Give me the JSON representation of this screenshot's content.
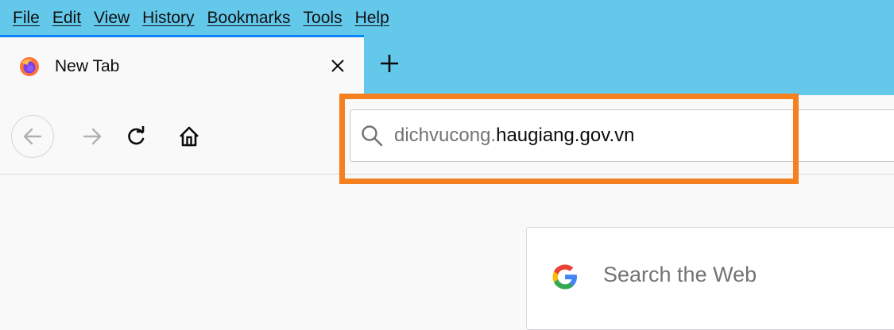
{
  "menu": [
    "File",
    "Edit",
    "View",
    "History",
    "Bookmarks",
    "Tools",
    "Help"
  ],
  "tab": {
    "title": "New Tab",
    "close_glyph": "×",
    "icon": "firefox-logo-icon"
  },
  "new_tab_glyph": "+",
  "toolbar": {
    "back_icon": "back-arrow-icon",
    "forward_icon": "forward-arrow-icon",
    "reload_icon": "reload-icon",
    "home_icon": "home-icon"
  },
  "url": {
    "subdomain": "dichvucong.",
    "domain": "haugiang.gov.vn"
  },
  "search": {
    "placeholder": "Search the Web",
    "engine_icon": "google-icon"
  },
  "colors": {
    "menubar": "#64c8eb",
    "highlight": "#f5801f",
    "tab_accent": "#0a84ff"
  }
}
